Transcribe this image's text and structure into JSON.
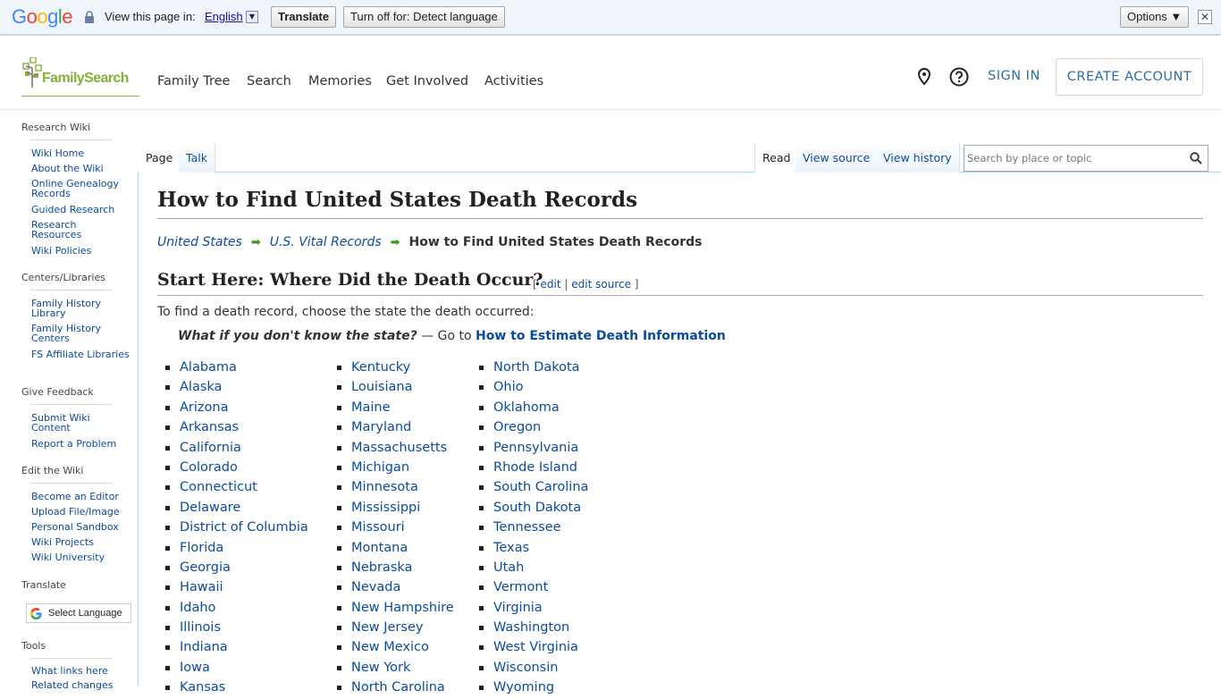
{
  "translate_bar": {
    "logo": "Google",
    "view_label": "View this page in:",
    "language": "English",
    "translate_button": "Translate",
    "turn_off_button": "Turn off for: Detect language",
    "options_button": "Options ▼",
    "close": "✕"
  },
  "header": {
    "logo_text": "FamilySearch",
    "nav": [
      "Family Tree",
      "Search",
      "Memories",
      "Get Involved",
      "Activities"
    ],
    "sign_in": "SIGN IN",
    "create_account": "CREATE ACCOUNT"
  },
  "sidebar": {
    "sections": [
      {
        "heading": "Research Wiki",
        "items": [
          "Wiki Home",
          "About the Wiki",
          "Online Genealogy Records",
          "Guided Research",
          "Research Resources",
          "Wiki Policies"
        ]
      },
      {
        "heading": "Centers/Libraries",
        "items": [
          "Family History Library",
          "Family History Centers",
          "FS Affiliate Libraries"
        ]
      },
      {
        "heading": "Give Feedback",
        "items": [
          "Submit Wiki Content",
          "Report a Problem"
        ]
      },
      {
        "heading": "Edit the Wiki",
        "items": [
          "Become an Editor",
          "Upload File/Image",
          "Personal Sandbox",
          "Wiki Projects",
          "Wiki University"
        ]
      },
      {
        "heading": "Translate",
        "items": []
      },
      {
        "heading": "Tools",
        "items": [
          "What links here",
          "Related changes"
        ]
      }
    ],
    "select_language": "Select Language"
  },
  "tabs": {
    "page": "Page",
    "talk": "Talk",
    "read": "Read",
    "view_source": "View source",
    "view_history": "View history"
  },
  "search": {
    "placeholder": "Search by place or topic"
  },
  "article": {
    "title": "How to Find United States Death Records",
    "breadcrumb": [
      "United States",
      "U.S. Vital Records",
      "How to Find United States Death Records"
    ],
    "section_heading": "Start Here: Where Did the Death Occur?",
    "edit_open": "[",
    "edit": "edit",
    "edit_sep": "|",
    "edit_source": "edit source",
    "edit_close": "]",
    "intro": "To find a death record, choose the state the death occurred:",
    "whatif_question": "What if you don't know the state?",
    "whatif_goto": " — Go to ",
    "whatif_link": "How to Estimate Death Information",
    "states_col1": [
      "Alabama",
      "Alaska",
      "Arizona",
      "Arkansas",
      "California",
      "Colorado",
      "Connecticut",
      "Delaware",
      "District of Columbia",
      "Florida",
      "Georgia",
      "Hawaii",
      "Idaho",
      "Illinois",
      "Indiana",
      "Iowa",
      "Kansas"
    ],
    "states_col2": [
      "Kentucky",
      "Louisiana",
      "Maine",
      "Maryland",
      "Massachusetts",
      "Michigan",
      "Minnesota",
      "Mississippi",
      "Missouri",
      "Montana",
      "Nebraska",
      "Nevada",
      "New Hampshire",
      "New Jersey",
      "New Mexico",
      "New York",
      "North Carolina"
    ],
    "states_col3": [
      "North Dakota",
      "Ohio",
      "Oklahoma",
      "Oregon",
      "Pennsylvania",
      "Rhode Island",
      "South Carolina",
      "South Dakota",
      "Tennessee",
      "Texas",
      "Utah",
      "Vermont",
      "Virginia",
      "Washington",
      "West Virginia",
      "Wisconsin",
      "Wyoming"
    ]
  }
}
